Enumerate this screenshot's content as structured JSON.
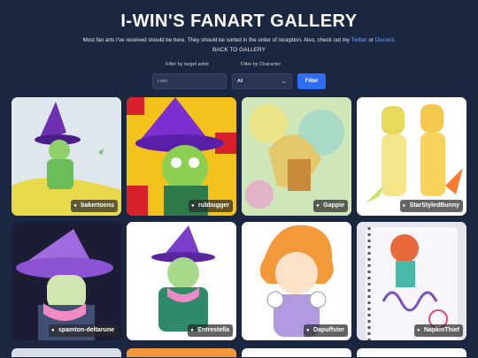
{
  "header": {
    "title": "I-WIN'S FANART GALLERY",
    "desc_pre": "Most fan arts I've received should be here. They should be sorted in the order of reception. Also, check out my ",
    "twitter": "Twitter",
    "desc_or": " or ",
    "discord": "Discord",
    "desc_end": ".",
    "back": "BACK TO GALLERY"
  },
  "filters": {
    "artist_label": "Filter by target artist",
    "artist_placeholder": "i-win",
    "character_label": "Filter by Character",
    "character_value": "All",
    "button": "Filter"
  },
  "cards": [
    {
      "artist": "bakertoons",
      "bg": "#dfe7ee"
    },
    {
      "artist": "rubbugger",
      "bg": "#f3c21b"
    },
    {
      "artist": "Gappie",
      "bg": "#cfe6b8"
    },
    {
      "artist": "StarStyledBunny",
      "bg": "#ffffff"
    },
    {
      "artist": "spamton-deltarune",
      "bg": "#1c1d35"
    },
    {
      "artist": "Entrestella",
      "bg": "#ffffff"
    },
    {
      "artist": "Dapuffster",
      "bg": "#ffffff"
    },
    {
      "artist": "NapkinThief",
      "bg": "#e7e4ee"
    }
  ],
  "colors": {
    "page_bg": "#1b2640",
    "accent": "#2f6cf5",
    "link": "#6ba6ff"
  }
}
